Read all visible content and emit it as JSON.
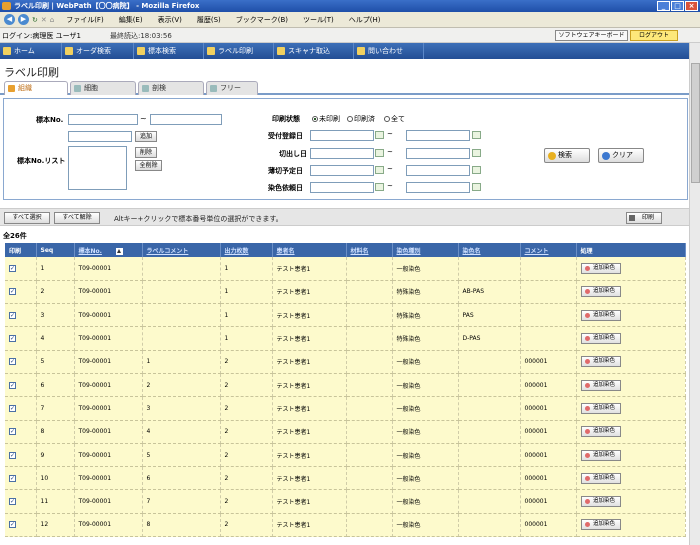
{
  "window": {
    "title": "ラベル印刷 | WebPath【〇〇病院】 - Mozilla Firefox"
  },
  "menu": [
    "ファイル(F)",
    "編集(E)",
    "表示(V)",
    "履歴(S)",
    "ブックマーク(B)",
    "ツール(T)",
    "ヘルプ(H)"
  ],
  "info": {
    "login": "ログイン:病理医 ユーザ1",
    "updated": "最終読込:18:03:56",
    "keyboard": "ソフトウェアキーボード",
    "logout": "ログアウト"
  },
  "nav": [
    "ホーム",
    "オーダ検索",
    "標本検索",
    "ラベル印刷",
    "スキャナ取込",
    "問い合わせ"
  ],
  "page": {
    "title": "ラベル印刷"
  },
  "tabs": [
    "組織",
    "細胞",
    "剖検",
    "フリー"
  ],
  "form": {
    "specimen_no": "標本No.",
    "tilde": "~",
    "add": "追加",
    "specimen_list": "標本No.リスト",
    "delete": "削除",
    "delete_all": "全削除",
    "print_status": "印刷状態",
    "radios": [
      "未印刷",
      "印刷済",
      "全て"
    ],
    "date_rows": [
      "受付登録日",
      "切出し日",
      "薄切予定日",
      "染色依頼日"
    ],
    "search": "検索",
    "clear": "クリア"
  },
  "actions": {
    "select_all": "すべて選択",
    "deselect_all": "すべて解除",
    "hint": "Altキー+クリックで標本番号単位の選択ができます。",
    "print": "印刷"
  },
  "count": "全26件",
  "table": {
    "headers": [
      "印刷",
      "Seq",
      "標本No.",
      "ラベルコメント",
      "出力枚数",
      "患者名",
      "材料名",
      "染色種別",
      "染色名",
      "コメント",
      "処理"
    ],
    "action_label": "追加染色",
    "rows": [
      {
        "seq": "1",
        "no": "T09-00001",
        "label": "",
        "count": "1",
        "patient": "テスト患者1",
        "material": "",
        "type": "一般染色",
        "stain": "",
        "comment": ""
      },
      {
        "seq": "2",
        "no": "T09-00001",
        "label": "",
        "count": "1",
        "patient": "テスト患者1",
        "material": "",
        "type": "特殊染色",
        "stain": "AB-PAS",
        "comment": ""
      },
      {
        "seq": "3",
        "no": "T09-00001",
        "label": "",
        "count": "1",
        "patient": "テスト患者1",
        "material": "",
        "type": "特殊染色",
        "stain": "PAS",
        "comment": ""
      },
      {
        "seq": "4",
        "no": "T09-00001",
        "label": "",
        "count": "1",
        "patient": "テスト患者1",
        "material": "",
        "type": "特殊染色",
        "stain": "D-PAS",
        "comment": ""
      },
      {
        "seq": "5",
        "no": "T09-00001",
        "label": "1",
        "count": "2",
        "patient": "テスト患者1",
        "material": "",
        "type": "一般染色",
        "stain": "",
        "comment": "000001"
      },
      {
        "seq": "6",
        "no": "T09-00001",
        "label": "2",
        "count": "2",
        "patient": "テスト患者1",
        "material": "",
        "type": "一般染色",
        "stain": "",
        "comment": "000001"
      },
      {
        "seq": "7",
        "no": "T09-00001",
        "label": "3",
        "count": "2",
        "patient": "テスト患者1",
        "material": "",
        "type": "一般染色",
        "stain": "",
        "comment": "000001"
      },
      {
        "seq": "8",
        "no": "T09-00001",
        "label": "4",
        "count": "2",
        "patient": "テスト患者1",
        "material": "",
        "type": "一般染色",
        "stain": "",
        "comment": "000001"
      },
      {
        "seq": "9",
        "no": "T09-00001",
        "label": "5",
        "count": "2",
        "patient": "テスト患者1",
        "material": "",
        "type": "一般染色",
        "stain": "",
        "comment": "000001"
      },
      {
        "seq": "10",
        "no": "T09-00001",
        "label": "6",
        "count": "2",
        "patient": "テスト患者1",
        "material": "",
        "type": "一般染色",
        "stain": "",
        "comment": "000001"
      },
      {
        "seq": "11",
        "no": "T09-00001",
        "label": "7",
        "count": "2",
        "patient": "テスト患者1",
        "material": "",
        "type": "一般染色",
        "stain": "",
        "comment": "000001"
      },
      {
        "seq": "12",
        "no": "T09-00001",
        "label": "8",
        "count": "2",
        "patient": "テスト患者1",
        "material": "",
        "type": "一般染色",
        "stain": "",
        "comment": "000001"
      }
    ]
  }
}
